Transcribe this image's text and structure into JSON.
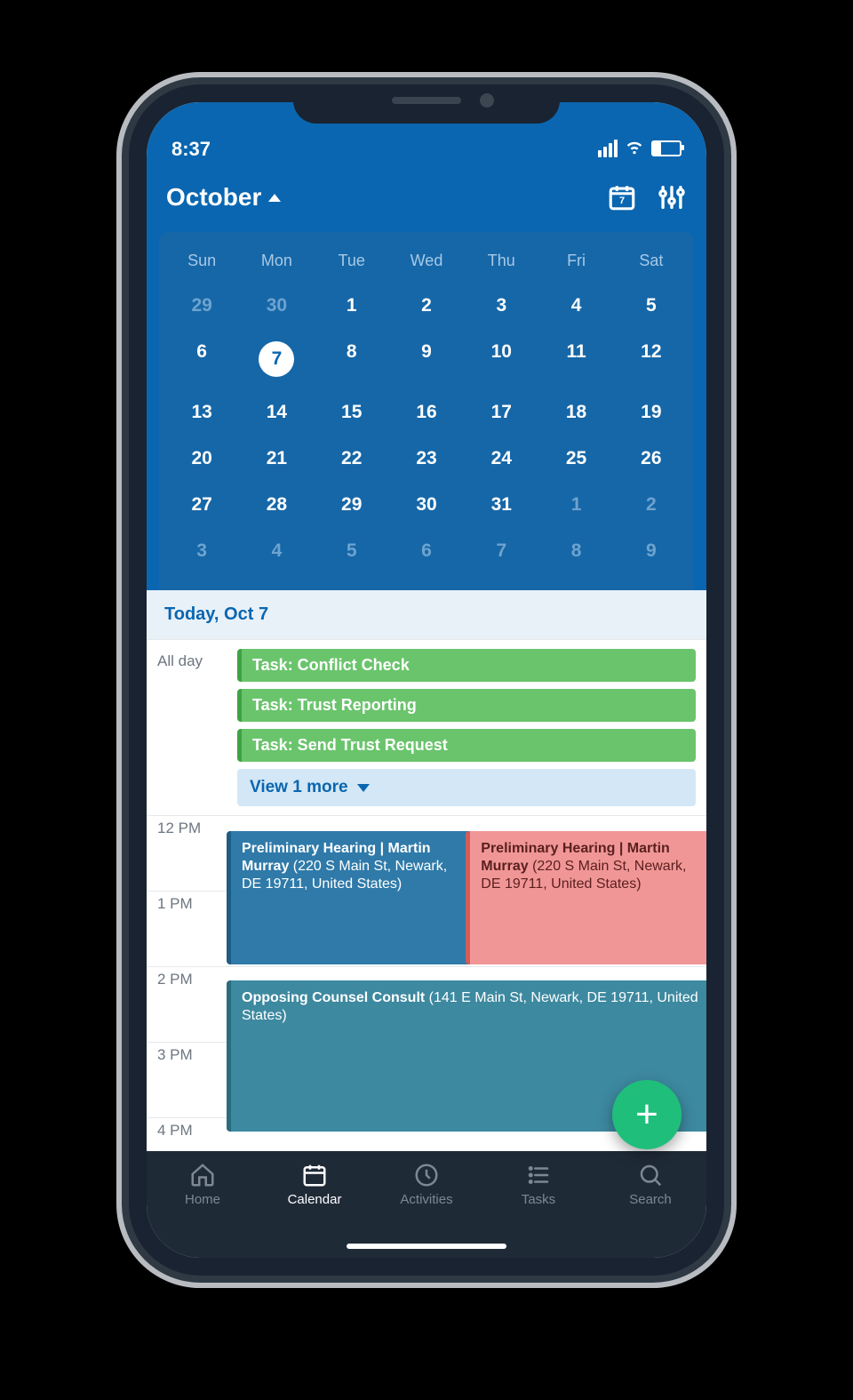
{
  "status": {
    "time": "8:37"
  },
  "header": {
    "month_label": "October",
    "today_button_icon": "calendar-today-icon",
    "filter_icon": "sliders-icon",
    "today_badge": "7"
  },
  "calendar": {
    "dow": [
      "Sun",
      "Mon",
      "Tue",
      "Wed",
      "Thu",
      "Fri",
      "Sat"
    ],
    "weeks": [
      [
        {
          "n": "29",
          "dim": true
        },
        {
          "n": "30",
          "dim": true
        },
        {
          "n": "1"
        },
        {
          "n": "2"
        },
        {
          "n": "3"
        },
        {
          "n": "4"
        },
        {
          "n": "5"
        }
      ],
      [
        {
          "n": "6"
        },
        {
          "n": "7",
          "selected": true
        },
        {
          "n": "8"
        },
        {
          "n": "9"
        },
        {
          "n": "10"
        },
        {
          "n": "11"
        },
        {
          "n": "12"
        }
      ],
      [
        {
          "n": "13"
        },
        {
          "n": "14"
        },
        {
          "n": "15"
        },
        {
          "n": "16"
        },
        {
          "n": "17"
        },
        {
          "n": "18"
        },
        {
          "n": "19"
        }
      ],
      [
        {
          "n": "20"
        },
        {
          "n": "21"
        },
        {
          "n": "22"
        },
        {
          "n": "23"
        },
        {
          "n": "24"
        },
        {
          "n": "25"
        },
        {
          "n": "26"
        }
      ],
      [
        {
          "n": "27"
        },
        {
          "n": "28"
        },
        {
          "n": "29"
        },
        {
          "n": "30"
        },
        {
          "n": "31"
        },
        {
          "n": "1",
          "dim": true
        },
        {
          "n": "2",
          "dim": true
        }
      ],
      [
        {
          "n": "3",
          "dim": true
        },
        {
          "n": "4",
          "dim": true
        },
        {
          "n": "5",
          "dim": true
        },
        {
          "n": "6",
          "dim": true
        },
        {
          "n": "7",
          "dim": true
        },
        {
          "n": "8",
          "dim": true
        },
        {
          "n": "9",
          "dim": true
        }
      ]
    ]
  },
  "today_banner": "Today, Oct 7",
  "all_day": {
    "label": "All day",
    "tasks": [
      "Task: Conflict Check",
      "Task: Trust Reporting",
      "Task: Send Trust Request"
    ],
    "view_more": "View 1 more"
  },
  "hours": [
    "12 PM",
    "1 PM",
    "2 PM",
    "3 PM",
    "4 PM"
  ],
  "events": {
    "e1": {
      "title": "Preliminary Hearing | Martin Murray",
      "loc": " (220 S Main St, Newark, DE 19711, United States)"
    },
    "e2": {
      "title": "Preliminary Hearing | Martin Murray",
      "loc": " (220 S Main St, Newark, DE 19711, United States)"
    },
    "e3": {
      "title": "Opposing Counsel Consult",
      "loc": " (141 E Main St, Newark, DE 19711, United States)"
    }
  },
  "fab": {
    "glyph": "+"
  },
  "nav": {
    "items": [
      {
        "label": "Home",
        "icon": "home-icon"
      },
      {
        "label": "Calendar",
        "icon": "calendar-icon",
        "active": true
      },
      {
        "label": "Activities",
        "icon": "clock-icon"
      },
      {
        "label": "Tasks",
        "icon": "list-icon"
      },
      {
        "label": "Search",
        "icon": "search-icon"
      }
    ]
  }
}
